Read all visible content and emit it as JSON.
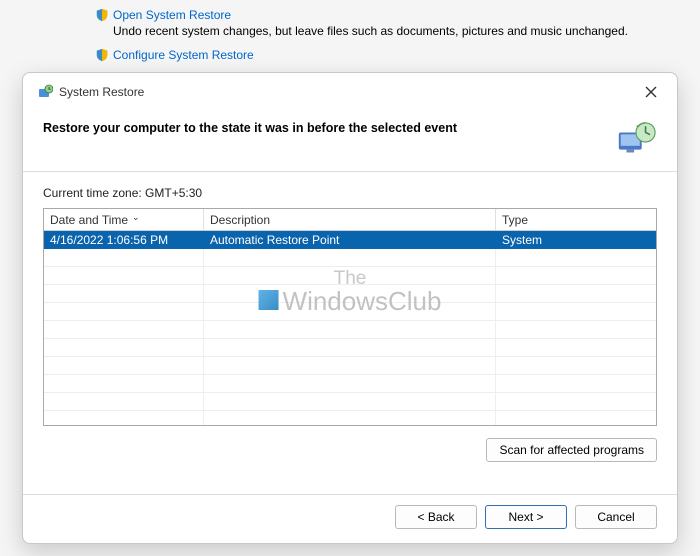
{
  "background": {
    "open_restore": "Open System Restore",
    "open_restore_desc": "Undo recent system changes, but leave files such as documents, pictures and music unchanged.",
    "configure_restore": "Configure System Restore"
  },
  "dialog": {
    "title": "System Restore",
    "heading": "Restore your computer to the state it was in before the selected event",
    "timezone": "Current time zone: GMT+5:30",
    "columns": {
      "datetime": "Date and Time",
      "description": "Description",
      "type": "Type"
    },
    "rows": [
      {
        "datetime": "4/16/2022 1:06:56 PM",
        "description": "Automatic Restore Point",
        "type": "System"
      }
    ],
    "scan_button": "Scan for affected programs",
    "buttons": {
      "back": "< Back",
      "next": "Next >",
      "cancel": "Cancel"
    }
  },
  "watermark": {
    "top": "The",
    "bottom": "WindowsClub"
  }
}
